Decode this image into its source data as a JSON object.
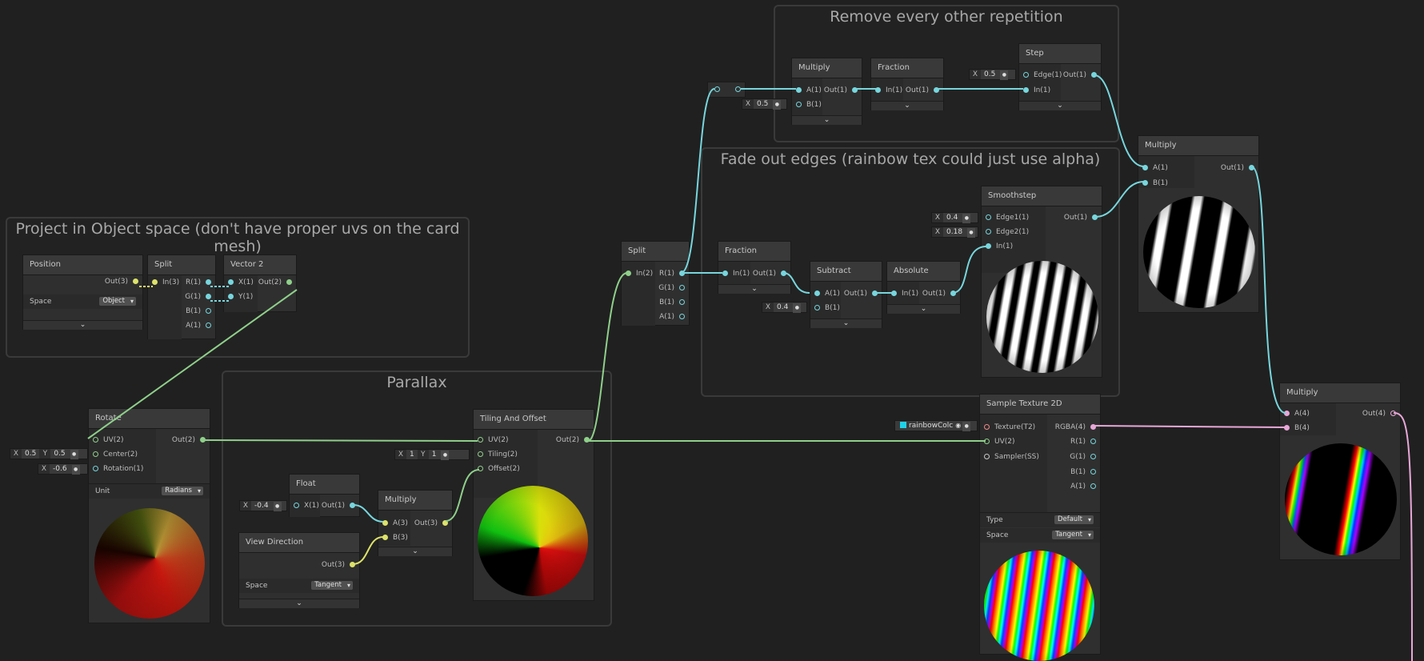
{
  "groups": {
    "remove": "Remove every other repetition",
    "fade": "Fade out edges (rainbow tex could just use alpha)",
    "project": "Project in Object space (don't have proper uvs on the card mesh)",
    "parallax": "Parallax"
  },
  "nodes": {
    "position": {
      "title": "Position",
      "out": "Out(3)",
      "space_label": "Space",
      "space_value": "Object"
    },
    "split_obj": {
      "title": "Split",
      "in": "In(3)",
      "r": "R(1)",
      "g": "G(1)",
      "b": "B(1)",
      "a": "A(1)"
    },
    "vector2": {
      "title": "Vector 2",
      "x": "X(1)",
      "y": "Y(1)",
      "out": "Out(2)"
    },
    "rotate": {
      "title": "Rotate",
      "uv": "UV(2)",
      "center": "Center(2)",
      "rotation": "Rotation(1)",
      "out": "Out(2)",
      "unit_label": "Unit",
      "unit_value": "Radians",
      "center_x": "0.5",
      "center_y": "0.5",
      "rotation_x": "-0.6"
    },
    "float": {
      "title": "Float",
      "x": "X(1)",
      "out": "Out(1)",
      "x_value": "-0.4"
    },
    "view_dir": {
      "title": "View Direction",
      "out": "Out(3)",
      "space_label": "Space",
      "space_value": "Tangent"
    },
    "multiply_par": {
      "title": "Multiply",
      "a": "A(3)",
      "b": "B(3)",
      "out": "Out(3)"
    },
    "tiling": {
      "title": "Tiling And Offset",
      "uv": "UV(2)",
      "tiling": "Tiling(2)",
      "offset": "Offset(2)",
      "out": "Out(2)",
      "tiling_x": "1",
      "tiling_y": "1"
    },
    "split_main": {
      "title": "Split",
      "in": "In(2)",
      "r": "R(1)",
      "g": "G(1)",
      "b": "B(1)",
      "a": "A(1)"
    },
    "multiply_top": {
      "title": "Multiply",
      "a": "A(1)",
      "b": "B(1)",
      "out": "Out(1)",
      "b_value": "0.5"
    },
    "fraction_top": {
      "title": "Fraction",
      "in": "In(1)",
      "out": "Out(1)"
    },
    "step": {
      "title": "Step",
      "edge": "Edge(1)",
      "in": "In(1)",
      "out": "Out(1)",
      "edge_value": "0.5"
    },
    "fraction_mid": {
      "title": "Fraction",
      "in": "In(1)",
      "out": "Out(1)"
    },
    "subtract": {
      "title": "Subtract",
      "a": "A(1)",
      "b": "B(1)",
      "out": "Out(1)",
      "b_value": "0.4"
    },
    "absolute": {
      "title": "Absolute",
      "in": "In(1)",
      "out": "Out(1)"
    },
    "smoothstep": {
      "title": "Smoothstep",
      "edge1": "Edge1(1)",
      "edge2": "Edge2(1)",
      "in": "In(1)",
      "out": "Out(1)",
      "edge1_value": "0.4",
      "edge2_value": "0.18"
    },
    "multiply_right": {
      "title": "Multiply",
      "a": "A(1)",
      "b": "B(1)",
      "out": "Out(1)"
    },
    "sample": {
      "title": "Sample Texture 2D",
      "texture": "Texture(T2)",
      "uv": "UV(2)",
      "sampler": "Sampler(SS)",
      "rgba": "RGBA(4)",
      "r": "R(1)",
      "g": "G(1)",
      "b": "B(1)",
      "a": "A(1)",
      "type_label": "Type",
      "type_value": "Default",
      "space_label": "Space",
      "space_value": "Tangent",
      "texture_value": "rainbowColc"
    },
    "multiply_final": {
      "title": "Multiply",
      "a": "A(4)",
      "b": "B(4)",
      "out": "Out(4)"
    }
  },
  "axis": {
    "x": "X",
    "y": "Y"
  },
  "icons": {
    "chevron": "chevron-down-icon",
    "dropdown": "dropdown-arrow-icon"
  },
  "colors": {
    "vector1": "#77d6dd",
    "vector2": "#8fd08a",
    "vector3": "#dde26a",
    "vector4": "#e8a7d8",
    "texture": "#f08a8a",
    "background": "#202020"
  }
}
